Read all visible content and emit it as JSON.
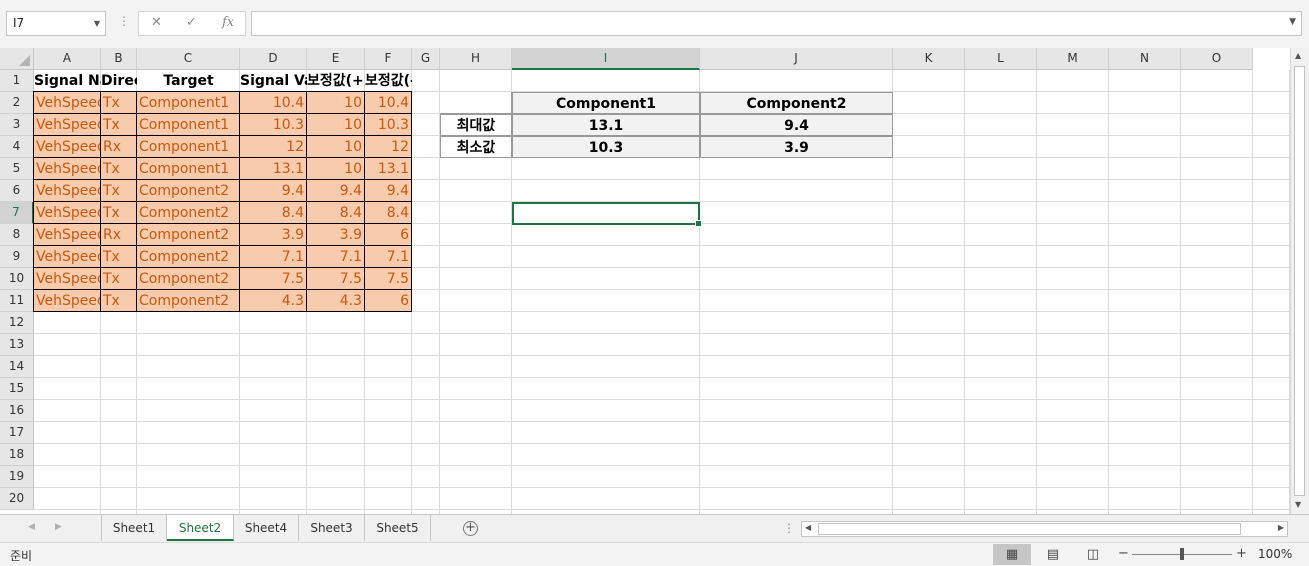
{
  "formula_bar": {
    "name_box": "I7",
    "formula": "",
    "cancel_icon": "✕",
    "enter_icon": "✓",
    "fx_icon": "fx"
  },
  "columns": [
    "A",
    "B",
    "C",
    "D",
    "E",
    "F",
    "G",
    "H",
    "I",
    "J",
    "K",
    "L",
    "M",
    "N",
    "O"
  ],
  "rows": [
    "1",
    "2",
    "3",
    "4",
    "5",
    "6",
    "7",
    "8",
    "9",
    "10",
    "11",
    "12",
    "13",
    "14",
    "15",
    "16",
    "17",
    "18",
    "19",
    "20"
  ],
  "selected_cell": "I7",
  "table": {
    "headers": [
      "Signal Name",
      "Direction",
      "Target",
      "Signal Value",
      "보정값(+)",
      "보정값(-)"
    ],
    "rows": [
      [
        "VehSpeed",
        "Tx",
        "Component1",
        "10.4",
        "10",
        "10.4"
      ],
      [
        "VehSpeed",
        "Tx",
        "Component1",
        "10.3",
        "10",
        "10.3"
      ],
      [
        "VehSpeed",
        "Rx",
        "Component1",
        "12",
        "10",
        "12"
      ],
      [
        "VehSpeed",
        "Tx",
        "Component1",
        "13.1",
        "10",
        "13.1"
      ],
      [
        "VehSpeed",
        "Tx",
        "Component2",
        "9.4",
        "9.4",
        "9.4"
      ],
      [
        "VehSpeed",
        "Tx",
        "Component2",
        "8.4",
        "8.4",
        "8.4"
      ],
      [
        "VehSpeed",
        "Rx",
        "Component2",
        "3.9",
        "3.9",
        "6"
      ],
      [
        "VehSpeed",
        "Tx",
        "Component2",
        "7.1",
        "7.1",
        "7.1"
      ],
      [
        "VehSpeed",
        "Tx",
        "Component2",
        "7.5",
        "7.5",
        "7.5"
      ],
      [
        "VehSpeed",
        "Tx",
        "Component2",
        "4.3",
        "4.3",
        "6"
      ]
    ]
  },
  "summary": {
    "col_headers": [
      "Component1",
      "Component2"
    ],
    "rows": [
      {
        "label": "최대값",
        "values": [
          "13.1",
          "9.4"
        ]
      },
      {
        "label": "최소값",
        "values": [
          "10.3",
          "3.9"
        ]
      }
    ]
  },
  "sheets": {
    "tabs": [
      "Sheet1",
      "Sheet2",
      "Sheet4",
      "Sheet3",
      "Sheet5"
    ],
    "active": "Sheet2",
    "add_icon": "+"
  },
  "status": {
    "ready": "준비",
    "zoom": "100%",
    "zoom_minus": "−",
    "zoom_plus": "+"
  },
  "colors": {
    "data_fill": "#f8cbad",
    "data_text": "#c65911",
    "accent": "#217346"
  }
}
